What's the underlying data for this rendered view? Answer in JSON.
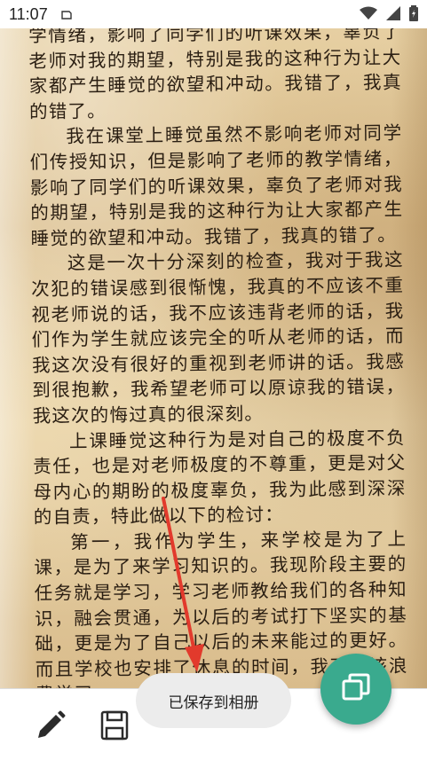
{
  "status_bar": {
    "time": "11:07",
    "left_icon": "sync-icon",
    "right_icons": [
      "wifi-icon",
      "signal-icon",
      "battery-icon"
    ]
  },
  "document": {
    "paragraphs": [
      "学情绪，影响了同学们的听课效果，辜负了老师对我的期望，特别是我的这种行为让大家都产生睡觉的欲望和冲动。我错了，我真的错了。",
      "我在课堂上睡觉虽然不影响老师对同学们传授知识，但是影响了老师的教学情绪，影响了同学们的听课效果，辜负了老师对我的期望，特别是我的这种行为让大家都产生睡觉的欲望和冲动。我错了，我真的错了。",
      "这是一次十分深刻的检查，我对于我这次犯的错误感到很惭愧，我真的不应该不重视老师说的话，我不应该违背老师的话，我们作为学生就应该完全的听从老师的话，而我这次没有很好的重视到老师讲的话。我感到很抱歉，我希望老师可以原谅我的错误，我这次的悔过真的很深刻。",
      "上课睡觉这种行为是对自己的极度不负责任，也是对老师极度的不尊重，更是对父母内心的期盼的极度辜负，我为此感到深深的自责，特此做以下的检讨：",
      "第一，我作为学生，来学校是为了上课，是为了来学习知识的。我现阶段主要的任务就是学习，学习老师教给我们的各种知识，融会贯通，为以后的考试打下坚实的基础，更是为了自己以后的未来能过的更好。而且学校也安排了休息的时间，我不应该浪费学习"
    ]
  },
  "toolbar": {
    "edit": "pencil-icon",
    "save": "save-icon"
  },
  "toast": {
    "message": "已保存到相册"
  },
  "fab": {
    "icon": "copy-icon"
  },
  "colors": {
    "fab": "#3aaa8e",
    "arrow": "#e23a2c",
    "ink": "#2a1e12"
  }
}
